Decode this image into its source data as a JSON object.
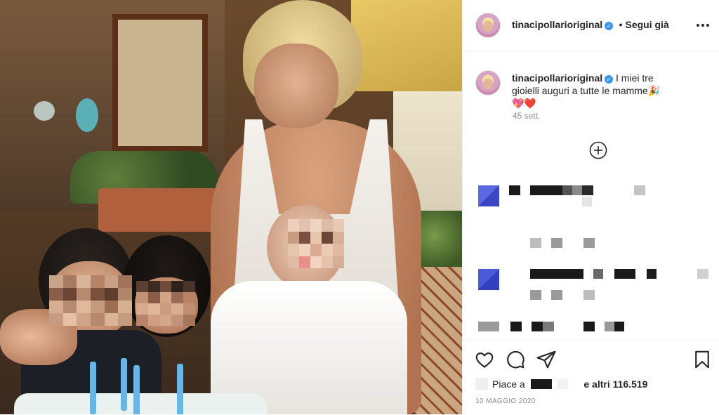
{
  "post": {
    "photo_alt": "Foto del post",
    "author": {
      "username": "tinacipollarioriginal",
      "verified": true,
      "follow_label": "Segui già",
      "separator": "•"
    },
    "more_options_icon": "more-horizontal-icon",
    "caption": {
      "username": "tinacipollarioriginal",
      "text": "I miei tre gioielli auguri a tutte le mamme🎉💖❤️",
      "time_ago": "45 sett."
    },
    "load_more_icon": "plus-circle-icon",
    "actions": {
      "like_icon": "heart-icon",
      "comment_icon": "comment-icon",
      "share_icon": "paper-plane-icon",
      "save_icon": "bookmark-icon"
    },
    "likes": {
      "prefix": "Piace a",
      "suffix": "e altri 116.519"
    },
    "date": "10 MAGGIO 2020"
  },
  "colors": {
    "verified": "#3897f0",
    "text": "#262626",
    "secondary": "#8e8e8e",
    "divider": "#efefef",
    "redacted_blue": "#3f51d6"
  }
}
